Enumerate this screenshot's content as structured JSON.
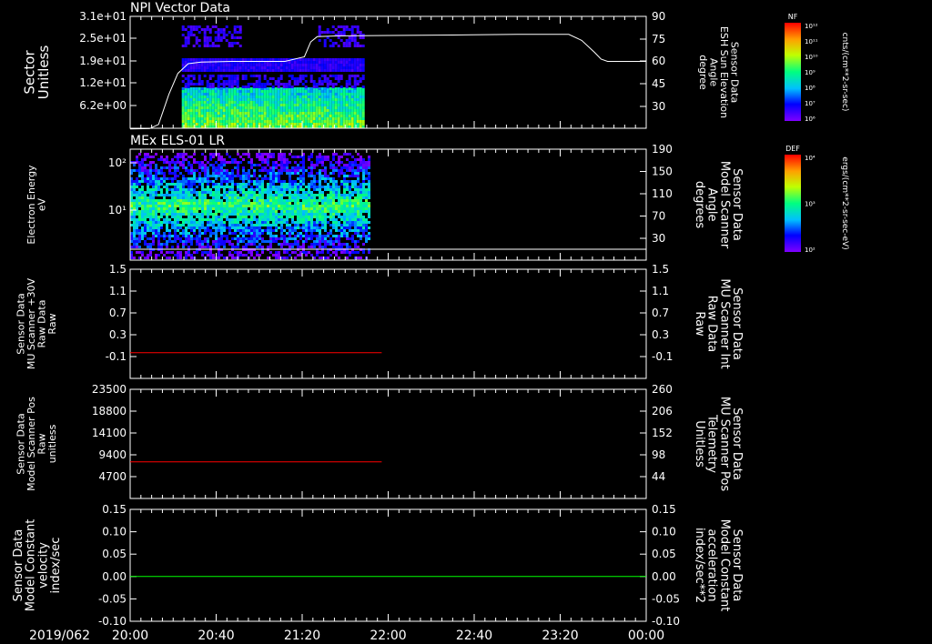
{
  "date_label": "2019/062",
  "time_axis": {
    "ticks": [
      "20:00",
      "20:40",
      "21:20",
      "22:00",
      "22:40",
      "23:20",
      "00:00"
    ],
    "range_hours": [
      20,
      24
    ]
  },
  "colorbars": [
    {
      "label": "NF",
      "units": "cnts/(cm**2-sr-sec)",
      "tick_labels": [
        "10¹²",
        "10¹¹",
        "10¹⁰",
        "10⁹",
        "10⁸",
        "10⁷",
        "10⁶"
      ]
    },
    {
      "label": "DEF",
      "units": "ergs/(cm**2-sr-sec-eV)",
      "tick_labels": [
        "10⁴",
        "10³",
        "10²"
      ]
    }
  ],
  "colors": {
    "line_white": "#ffffff",
    "line_red": "#ff0000",
    "line_green": "#00ff00",
    "axis": "#ffffff"
  },
  "chart_data": [
    {
      "type": "heatmap",
      "title": "NPI Vector Data",
      "ylabel": "Sector\nUnitless",
      "y_tick_labels": [
        "3.1e+01",
        "2.5e+01",
        "1.9e+01",
        "1.2e+01",
        "6.2e+00"
      ],
      "y_log": false,
      "right_axis": {
        "label": "Sensor Data\nESH Sun Elevation\nAngle\ndegree",
        "tick_labels": [
          "90",
          "75",
          "60",
          "45",
          "30"
        ],
        "range": [
          15,
          90
        ]
      },
      "data_extent_hours": [
        20.4,
        21.8
      ],
      "series": [
        {
          "name": "",
          "type": "line",
          "color": "#ffffff",
          "x_hours": [
            20.0,
            20.15,
            20.22,
            20.3,
            20.37,
            20.45,
            20.55,
            20.8,
            21.2,
            21.35,
            21.4,
            21.45,
            21.6,
            22.0,
            22.5,
            23.0,
            23.4,
            23.5,
            23.6,
            23.65,
            23.7,
            24.0
          ],
          "values": [
            15.0,
            15.2,
            18.0,
            38.0,
            52.0,
            58.5,
            59.5,
            60.0,
            60.0,
            63.0,
            73.0,
            76.5,
            77.0,
            77.3,
            77.6,
            78.0,
            78.0,
            74.0,
            66.0,
            61.5,
            60.0,
            60.0
          ]
        }
      ]
    },
    {
      "type": "heatmap",
      "title": "MEx ELS-01 LR",
      "ylabel": "Electron Energy\neV",
      "y_tick_labels": [
        "10²",
        "10¹"
      ],
      "y_log": true,
      "right_axis": {
        "label": "Sensor Data\nModel Scanner\nAngle\ndegrees",
        "tick_labels": [
          "190",
          "150",
          "110",
          "70",
          "30"
        ],
        "range": [
          0,
          190
        ]
      },
      "data_extent_hours": [
        20.0,
        21.85
      ],
      "series": [
        {
          "name": "",
          "type": "line",
          "color": "#ffffff",
          "x_hours": [
            20.0,
            24.0
          ],
          "values": [
            2,
            2
          ]
        }
      ]
    },
    {
      "type": "line",
      "ylabel": "Sensor Data\nMU Scanner +30V\nRaw Data\nRaw",
      "y_tick_labels": [
        "1.5",
        "1.1",
        "0.7",
        "0.3",
        "-0.1"
      ],
      "ylim": [
        -0.3,
        1.5
      ],
      "right_axis": {
        "label": "Sensor Data\nMU Scanner Int\nRaw Data\nRaw",
        "tick_labels": [
          "1.5",
          "1.1",
          "0.7",
          "0.3",
          "-0.1"
        ],
        "color": "#ff0000"
      },
      "series": [
        {
          "name": "",
          "color": "#ff0000",
          "x_hours": [
            20.0,
            21.95
          ],
          "values": [
            -0.03,
            -0.03
          ]
        }
      ]
    },
    {
      "type": "line",
      "ylabel": "Sensor Data\nModel Scanner Pos\nRaw\nunitless",
      "y_tick_labels": [
        "23500",
        "18800",
        "14100",
        "9400",
        "4700"
      ],
      "ylim": [
        0,
        23500
      ],
      "right_axis": {
        "label": "Sensor Data\nMU Scanner Pos\nTelemetry\nUnitless",
        "tick_labels": [
          "260",
          "206",
          "152",
          "98",
          "44"
        ],
        "color": "#ff0000"
      },
      "series": [
        {
          "name": "",
          "color": "#ff0000",
          "x_hours": [
            20.0,
            21.95
          ],
          "values": [
            7900,
            7900
          ]
        }
      ]
    },
    {
      "type": "line",
      "ylabel": "Sensor Data\nModel Constant\nvelocity\nindex/sec",
      "y_tick_labels": [
        "0.15",
        "0.10",
        "0.05",
        "0.00",
        "-0.05",
        "-0.10"
      ],
      "ylim": [
        -0.1,
        0.15
      ],
      "right_axis": {
        "label": "Sensor Data\nModel Constant\nacceleration\nindex/sec**2",
        "tick_labels": [
          "0.15",
          "0.10",
          "0.05",
          "0.00",
          "-0.05",
          "-0.10"
        ],
        "color": "#00ff00"
      },
      "series": [
        {
          "name": "",
          "color": "#00ff00",
          "x_hours": [
            20.0,
            24.0
          ],
          "values": [
            0.0,
            0.0
          ]
        }
      ]
    }
  ]
}
